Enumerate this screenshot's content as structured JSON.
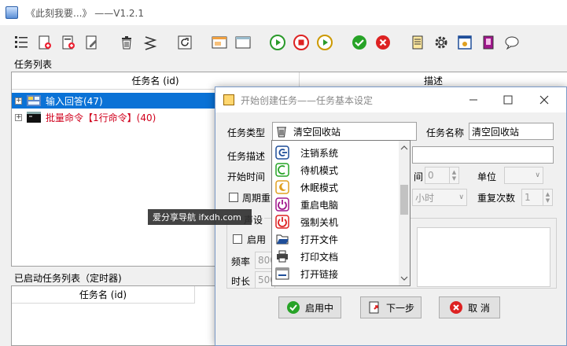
{
  "window": {
    "title": "《此刻我要...》      ——V1.2.1"
  },
  "toolbar": {
    "icons": [
      "list-icon",
      "add-doc-icon",
      "add-doc-red-icon",
      "edit-icon",
      "delete-icon",
      "clear-icon",
      "refresh-icon",
      "window-icon",
      "window-blank-icon",
      "play-icon",
      "stop-icon",
      "play-alt-icon",
      "ok-icon",
      "cancel-icon",
      "notes-icon",
      "gear-icon",
      "image-icon",
      "book-icon",
      "chat-icon"
    ]
  },
  "task_list": {
    "label": "任务列表",
    "col_name": "任务名 (id)",
    "col_desc": "描述",
    "rows": [
      {
        "text": "输入回答(47)",
        "selected": true
      },
      {
        "text": "批量命令【1行命令】(40)",
        "selected": false
      }
    ]
  },
  "active_list": {
    "label": "已启动任务列表（定时器)",
    "col_name": "任务名 (id)"
  },
  "watermark": "爱分享导航 ifxdh.com",
  "dialog": {
    "title": "开始创建任务——任务基本设定",
    "task_type_label": "任务类型",
    "task_type_value": "清空回收站",
    "task_name_label": "任务名称",
    "task_name_value": "清空回收站",
    "task_desc_label": "任务描述",
    "start_time_label": "开始时间",
    "interval_label_partial": "间",
    "interval_value": "0",
    "unit_label": "单位",
    "periodic_label_partial": "周期重",
    "hour_partial": "小时",
    "repeat_label": "重复次数",
    "repeat_value": "1",
    "sound_label_partial": "声设",
    "enable_label": "启用",
    "freq_label": "频率",
    "freq_value_partial": "800",
    "duration_label": "时长",
    "duration_value_partial": "500",
    "btn_enable": "启用中",
    "btn_next": "下一步",
    "btn_cancel": "取 消"
  },
  "dropdown": {
    "items": [
      {
        "label": "注销系统",
        "icon": "logoff-icon"
      },
      {
        "label": "待机模式",
        "icon": "standby-icon"
      },
      {
        "label": "休眠模式",
        "icon": "hibernate-icon"
      },
      {
        "label": "重启电脑",
        "icon": "restart-icon"
      },
      {
        "label": "强制关机",
        "icon": "power-icon"
      },
      {
        "label": "打开文件",
        "icon": "open-file-icon"
      },
      {
        "label": "打印文档",
        "icon": "print-icon"
      },
      {
        "label": "打开链接",
        "icon": "link-icon"
      }
    ]
  }
}
